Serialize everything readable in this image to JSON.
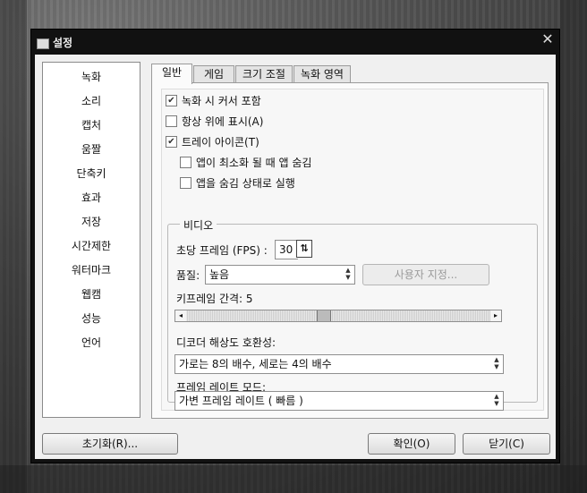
{
  "window": {
    "title": "설정",
    "close_glyph": "✕"
  },
  "sidebar": {
    "items": [
      {
        "label": "녹화"
      },
      {
        "label": "소리"
      },
      {
        "label": "캡처"
      },
      {
        "label": "움짤"
      },
      {
        "label": "단축키"
      },
      {
        "label": "효과"
      },
      {
        "label": "저장"
      },
      {
        "label": "시간제한"
      },
      {
        "label": "워터마크"
      },
      {
        "label": "웹캠"
      },
      {
        "label": "성능"
      },
      {
        "label": "언어"
      }
    ]
  },
  "tabs": [
    {
      "label": "일반",
      "active": true
    },
    {
      "label": "게임",
      "active": false
    },
    {
      "label": "크기 조절",
      "active": false
    },
    {
      "label": "녹화 영역",
      "active": false
    }
  ],
  "general": {
    "options": [
      {
        "label": "녹화 시 커서 포함",
        "checked": true
      },
      {
        "label": "항상 위에 표시(A)",
        "checked": false
      },
      {
        "label": "트레이 아이콘(T)",
        "checked": true
      },
      {
        "label": "앱이 최소화 될 때 앱 숨김",
        "checked": false
      },
      {
        "label": "앱을 숨김 상태로 실행",
        "checked": false
      }
    ],
    "check_glyph": "✔"
  },
  "video": {
    "group_label": "비디오",
    "fps_label": "초당 프레임 (FPS) :",
    "fps_value": "30",
    "quality_label": "품질:",
    "quality_value": "높음",
    "custom_button": "사용자 지정...",
    "keyframe_label": "키프레임 간격: 5",
    "keyframe_interval": 5,
    "decoder_label": "디코더 해상도 호환성:",
    "decoder_value": "가로는 8의 배수, 세로는 4의 배수",
    "framerate_mode_label": "프레임 레이트 모드:",
    "framerate_mode_value": "가변 프레임 레이트 ( 빠름 )"
  },
  "buttons": {
    "reset": "초기화(R)...",
    "ok": "확인(O)",
    "close": "닫기(C)"
  },
  "icons": {
    "app": "settings-app-icon",
    "fps_toggle": "fps-spin-icon",
    "spin_up": "▲",
    "spin_down": "▼",
    "left": "◂",
    "right": "▸"
  }
}
